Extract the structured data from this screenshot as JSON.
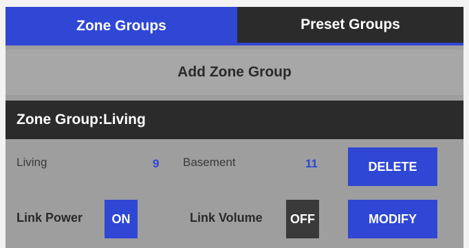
{
  "tabs": {
    "zone_groups": "Zone Groups",
    "preset_groups": "Preset Groups",
    "active": "Zone Groups"
  },
  "add_button": "Add Zone Group",
  "group": {
    "title": "Zone Group:Living",
    "zones": [
      {
        "name": "Living",
        "value": "9"
      },
      {
        "name": "Basement",
        "value": "11"
      }
    ],
    "link_power_label": "Link Power",
    "link_power_state": "ON",
    "link_volume_label": "Link Volume",
    "link_volume_state": "OFF",
    "delete_label": "DELETE",
    "modify_label": "MODIFY"
  },
  "colors": {
    "accent": "#2f47d4",
    "dark": "#2b2b2b",
    "panel": "#9e9e9e"
  }
}
